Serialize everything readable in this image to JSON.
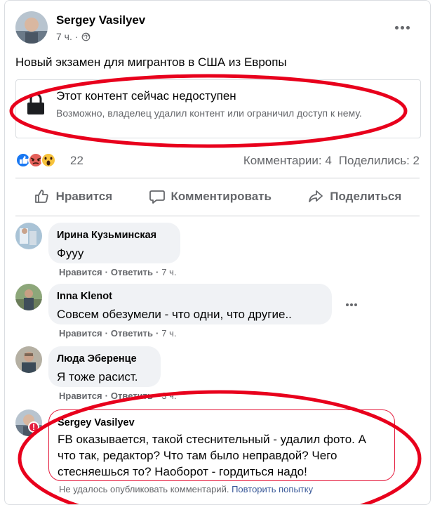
{
  "post": {
    "author": "Sergey Vasilyev",
    "time": "7 ч.",
    "separator": "·",
    "text": "Новый экзамен для мигрантов в США из Европы",
    "unavailable_title": "Этот контент сейчас недоступен",
    "unavailable_desc": "Возможно, владелец удалил контент или ограничил доступ к нему."
  },
  "stats": {
    "reaction_count": "22",
    "reactions": [
      "like",
      "angry",
      "wow"
    ],
    "comments": "Комментарии: 4",
    "shares": "Поделились: 2"
  },
  "actions": {
    "like": "Нравится",
    "comment": "Комментировать",
    "share": "Поделиться"
  },
  "comments": [
    {
      "name": "Ирина Кузьминская",
      "text": "Фууу",
      "like": "Нравится",
      "reply": "Ответить",
      "time": "7 ч."
    },
    {
      "name": "Inna Klenot",
      "text": "Совсем обезумели - что одни, что другие..",
      "like": "Нравится",
      "reply": "Ответить",
      "time": "7 ч."
    },
    {
      "name": "Люда Эберенце",
      "text": "Я тоже расист.",
      "like": "Нравится",
      "reply": "Ответить",
      "time": "3 ч."
    },
    {
      "name": "Sergey Vasilyev",
      "text": "FB оказывается, такой стеснительный - удалил фото. А что так, редактор? Что там было неправдой? Чего стесняешься то? Наоборот - гордиться надо!",
      "error_mark": "!",
      "failed": "Не удалось опубликовать комментарий.",
      "retry": "Повторить попытку"
    }
  ],
  "colors": {
    "annotation_red": "#e8001c",
    "text_secondary": "#65676b",
    "bubble_bg": "#f0f2f5",
    "error_red": "#e41e3f"
  }
}
